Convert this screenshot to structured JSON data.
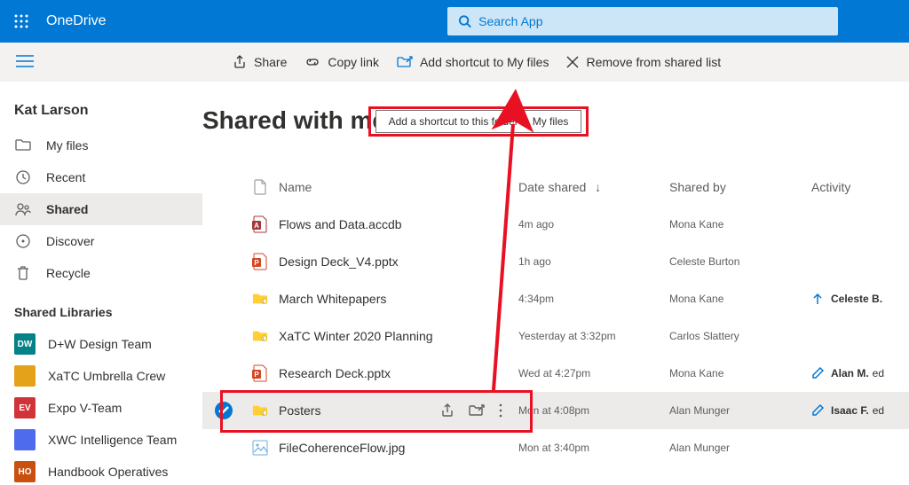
{
  "app": {
    "name": "OneDrive"
  },
  "search": {
    "placeholder": "Search App"
  },
  "commands": {
    "share": "Share",
    "copylink": "Copy link",
    "addshortcut": "Add shortcut to My files",
    "remove": "Remove from shared list"
  },
  "tooltip": "Add a shortcut to this folder in My files",
  "user": {
    "name": "Kat Larson"
  },
  "nav": {
    "myfiles": "My files",
    "recent": "Recent",
    "shared": "Shared",
    "discover": "Discover",
    "recycle": "Recycle"
  },
  "libs_header": "Shared Libraries",
  "libraries": [
    {
      "abbr": "DW",
      "name": "D+W Design Team",
      "color": "#038387"
    },
    {
      "abbr": "",
      "name": "XaTC Umbrella Crew",
      "color": "#e3a21a"
    },
    {
      "abbr": "EV",
      "name": "Expo V-Team",
      "color": "#d13438"
    },
    {
      "abbr": "",
      "name": "XWC Intelligence Team",
      "color": "#4f6bed"
    },
    {
      "abbr": "HO",
      "name": "Handbook Operatives",
      "color": "#ca5010"
    }
  ],
  "page": {
    "title": "Shared with me"
  },
  "columns": {
    "name": "Name",
    "date": "Date shared",
    "shared": "Shared by",
    "activity": "Activity"
  },
  "rows": [
    {
      "icon": "access",
      "name": "Flows and Data.accdb",
      "date": "4m ago",
      "shared": "Mona Kane",
      "activity": {
        "type": "none"
      }
    },
    {
      "icon": "ppt",
      "name": "Design Deck_V4.pptx",
      "date": "1h ago",
      "shared": "Celeste Burton",
      "activity": {
        "type": "none"
      }
    },
    {
      "icon": "folder",
      "name": "March Whitepapers",
      "date": "4:34pm",
      "shared": "Mona Kane",
      "activity": {
        "type": "share",
        "who": "Celeste B."
      }
    },
    {
      "icon": "folder",
      "name": "XaTC Winter 2020 Planning",
      "date": "Yesterday at 3:32pm",
      "shared": "Carlos Slattery",
      "activity": {
        "type": "none"
      }
    },
    {
      "icon": "ppt",
      "name": "Research Deck.pptx",
      "date": "Wed at 4:27pm",
      "shared": "Mona Kane",
      "activity": {
        "type": "edit",
        "who": "Alan M.",
        "suffix": "ed"
      }
    },
    {
      "icon": "folder",
      "name": "Posters",
      "selected": true,
      "date": "Mon at 4:08pm",
      "shared": "Alan Munger",
      "activity": {
        "type": "edit",
        "who": "Isaac F.",
        "suffix": "ed"
      }
    },
    {
      "icon": "image",
      "name": "FileCoherenceFlow.jpg",
      "date": "Mon at 3:40pm",
      "shared": "Alan Munger",
      "activity": {
        "type": "none"
      }
    }
  ]
}
